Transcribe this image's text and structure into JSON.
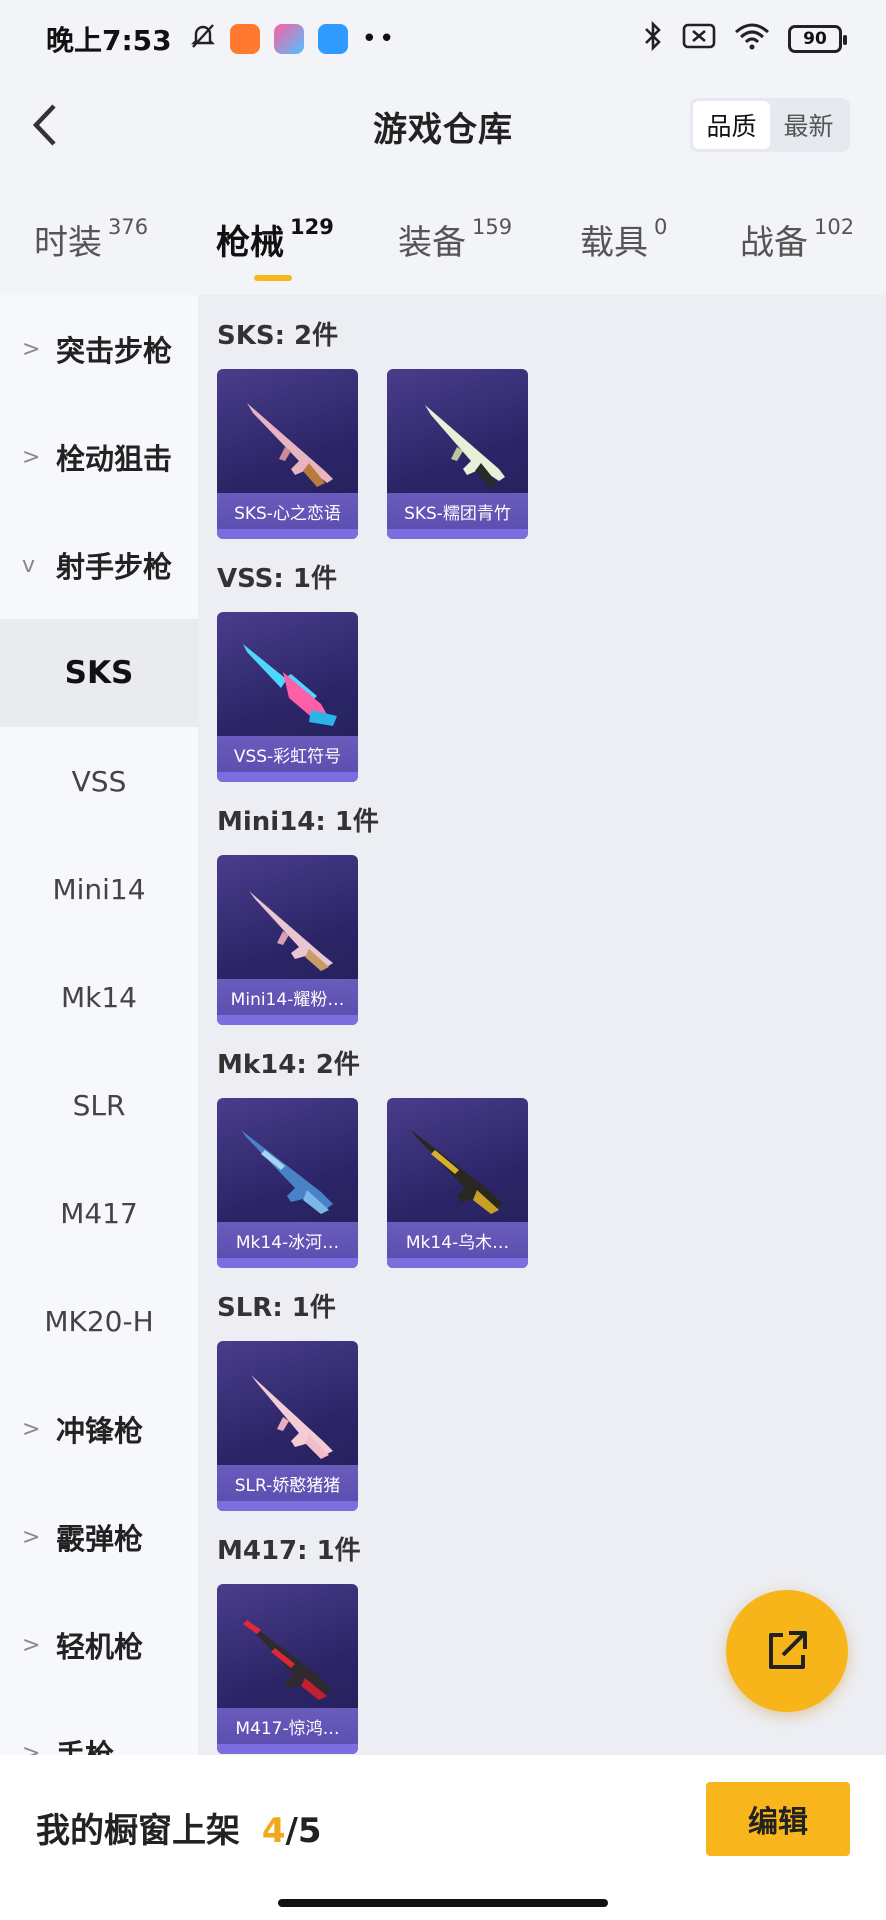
{
  "status_bar": {
    "time": "晚上7:53",
    "battery": "90",
    "icons": [
      "mute-icon",
      "taobao-app-icon",
      "game-app-icon",
      "chat-app-icon",
      "more-dots-icon",
      "bluetooth-icon",
      "sim-icon",
      "wifi-icon",
      "battery-icon"
    ]
  },
  "header": {
    "title": "游戏仓库",
    "sort_options": [
      "品质",
      "最新"
    ],
    "sort_active": "品质"
  },
  "tabs": [
    {
      "label": "时装",
      "count": "376"
    },
    {
      "label": "枪械",
      "count": "129",
      "active": true
    },
    {
      "label": "装备",
      "count": "159"
    },
    {
      "label": "载具",
      "count": "0"
    },
    {
      "label": "战备",
      "count": "102"
    }
  ],
  "sidebar": {
    "categories": [
      {
        "label": "突击步枪",
        "chevron": ">"
      },
      {
        "label": "栓动狙击",
        "chevron": ">"
      },
      {
        "label": "射手步枪",
        "chevron": "v"
      },
      {
        "label": "冲锋枪",
        "chevron": ">"
      },
      {
        "label": "霰弹枪",
        "chevron": ">"
      },
      {
        "label": "轻机枪",
        "chevron": ">"
      },
      {
        "label": "手枪",
        "chevron": ">"
      }
    ],
    "subitems": [
      "SKS",
      "VSS",
      "Mini14",
      "Mk14",
      "SLR",
      "M417",
      "MK20-H"
    ],
    "active_subitem": "SKS"
  },
  "groups": [
    {
      "title": "SKS: 2件",
      "items": [
        "SKS-心之恋语",
        "SKS-糯团青竹"
      ]
    },
    {
      "title": "VSS: 1件",
      "items": [
        "VSS-彩虹符号"
      ]
    },
    {
      "title": "Mini14: 1件",
      "items": [
        "Mini14-耀粉…"
      ]
    },
    {
      "title": "Mk14: 2件",
      "items": [
        "Mk14-冰河…",
        "Mk14-乌木…"
      ]
    },
    {
      "title": "SLR: 1件",
      "items": [
        "SLR-娇憨猪猪"
      ]
    },
    {
      "title": "M417: 1件",
      "items": [
        "M417-惊鸿…"
      ]
    }
  ],
  "bottom": {
    "shelf_label": "我的橱窗上架",
    "shelf_used": "4",
    "shelf_total": "/5",
    "edit_label": "编辑"
  },
  "colors": {
    "accent": "#f7b51a",
    "card_bg": "#2b2567",
    "card_label": "#5c4fb0"
  }
}
